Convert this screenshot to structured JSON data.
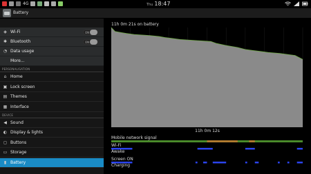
{
  "status": {
    "day": "Thu",
    "time": "18:47",
    "network": "4G",
    "left_icons": [
      "alert-icon",
      "photo-icon",
      "image-icon",
      "network-4g-icon",
      "mail-icon",
      "bug-icon",
      "upload-icon",
      "sync-icon",
      "android-icon"
    ],
    "right_icons": [
      "wifi-icon",
      "signal-icon",
      "battery-icon"
    ]
  },
  "actionbar": {
    "title": "Battery",
    "icon": "settings-battery-icon"
  },
  "sidebar": {
    "wireless": [
      {
        "icon": "wifi-icon",
        "label": "Wi-Fi",
        "toggle": "ON"
      },
      {
        "icon": "bluetooth-icon",
        "label": "Bluetooth",
        "toggle": "ON"
      },
      {
        "icon": "data-usage-icon",
        "label": "Data usage"
      },
      {
        "icon": "",
        "label": "More..."
      }
    ],
    "personalisation_header": "PERSONALISATION",
    "personalisation": [
      {
        "icon": "home-icon",
        "label": "Home"
      },
      {
        "icon": "lock-icon",
        "label": "Lock screen"
      },
      {
        "icon": "themes-icon",
        "label": "Themes"
      },
      {
        "icon": "interface-icon",
        "label": "Interface"
      }
    ],
    "device_header": "DEVICE",
    "device": [
      {
        "icon": "sound-icon",
        "label": "Sound"
      },
      {
        "icon": "display-icon",
        "label": "Display & lights"
      },
      {
        "icon": "buttons-icon",
        "label": "Buttons"
      },
      {
        "icon": "storage-icon",
        "label": "Storage"
      },
      {
        "icon": "battery-icon",
        "label": "Battery",
        "selected": true
      }
    ]
  },
  "chart_data": {
    "type": "area",
    "title": "11h 0m 21s on battery",
    "xlabel": "11h 0m 12s",
    "ylabel": "",
    "ylim": [
      0,
      100
    ],
    "x": [
      0,
      2,
      5,
      8,
      12,
      20,
      25,
      28,
      32,
      36,
      44,
      52,
      55,
      60,
      66,
      70,
      74,
      78,
      82,
      88,
      92,
      96,
      98,
      100
    ],
    "values": [
      100,
      96,
      95,
      94,
      93,
      92,
      91,
      90,
      89,
      88,
      87,
      86,
      84,
      82,
      80,
      78,
      77,
      76,
      75,
      74,
      73,
      72,
      70,
      68
    ],
    "fill_color": "#8a8a8a",
    "line_color": "#6ea845",
    "tracks": [
      {
        "label": "Mobile network signal",
        "color": "#4a8a2a",
        "segments": [
          [
            0,
            100
          ]
        ],
        "highlight": {
          "color": "#b07a2f",
          "segments": [
            [
              50,
              66
            ],
            [
              72,
              75
            ]
          ]
        }
      },
      {
        "label": "Wi-Fi",
        "color": "#2b44ee",
        "segments": [
          [
            0,
            11
          ],
          [
            45,
            53
          ],
          [
            70,
            75
          ],
          [
            97,
            100
          ]
        ]
      },
      {
        "label": "Awake",
        "color": "#2b44ee",
        "segments": []
      },
      {
        "label": "Screen ON",
        "color": "#2b44ee",
        "segments": [
          [
            0,
            11
          ],
          [
            44,
            45
          ],
          [
            48,
            50
          ],
          [
            53,
            60
          ],
          [
            70,
            71
          ],
          [
            75,
            77
          ],
          [
            87,
            88
          ],
          [
            92,
            93
          ],
          [
            97,
            100
          ]
        ]
      },
      {
        "label": "Charging",
        "color": "#2b44ee",
        "segments": []
      }
    ]
  }
}
